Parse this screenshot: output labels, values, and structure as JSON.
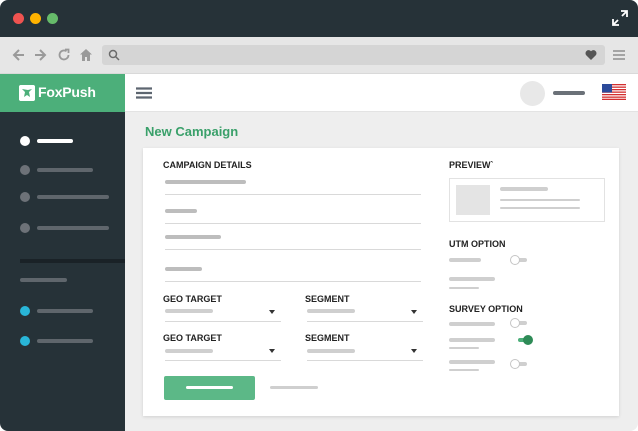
{
  "browser": {
    "title_dots": [
      "close",
      "minimize",
      "maximize"
    ],
    "icons": [
      "back-arrow-icon",
      "forward-arrow-icon",
      "refresh-icon",
      "home-icon",
      "search-icon",
      "heart-icon",
      "menu-icon",
      "expand-icon"
    ]
  },
  "brand": {
    "name": "FoxPush",
    "color": "#4caf7a"
  },
  "sidebar": {
    "items": [
      {
        "state": "active"
      },
      {
        "state": "normal"
      },
      {
        "state": "normal"
      },
      {
        "state": "normal"
      },
      {
        "state": "section-label"
      },
      {
        "state": "accent"
      },
      {
        "state": "accent"
      }
    ],
    "accent_color": "#29b6d8"
  },
  "page": {
    "title": "New Campaign"
  },
  "form": {
    "campaign_details_title": "CAMPAIGN DETAILS",
    "geo_target_label_1": "GEO TARGET",
    "segment_label_1": "SEGMENT",
    "geo_target_label_2": "GEO TARGET",
    "segment_label_2": "SEGMENT"
  },
  "preview": {
    "title": "PREVIEW`"
  },
  "utm": {
    "title": "UTM OPTION",
    "toggle_on": false
  },
  "survey": {
    "title": "SURVEY OPTION",
    "toggles": [
      false,
      true,
      false
    ]
  }
}
